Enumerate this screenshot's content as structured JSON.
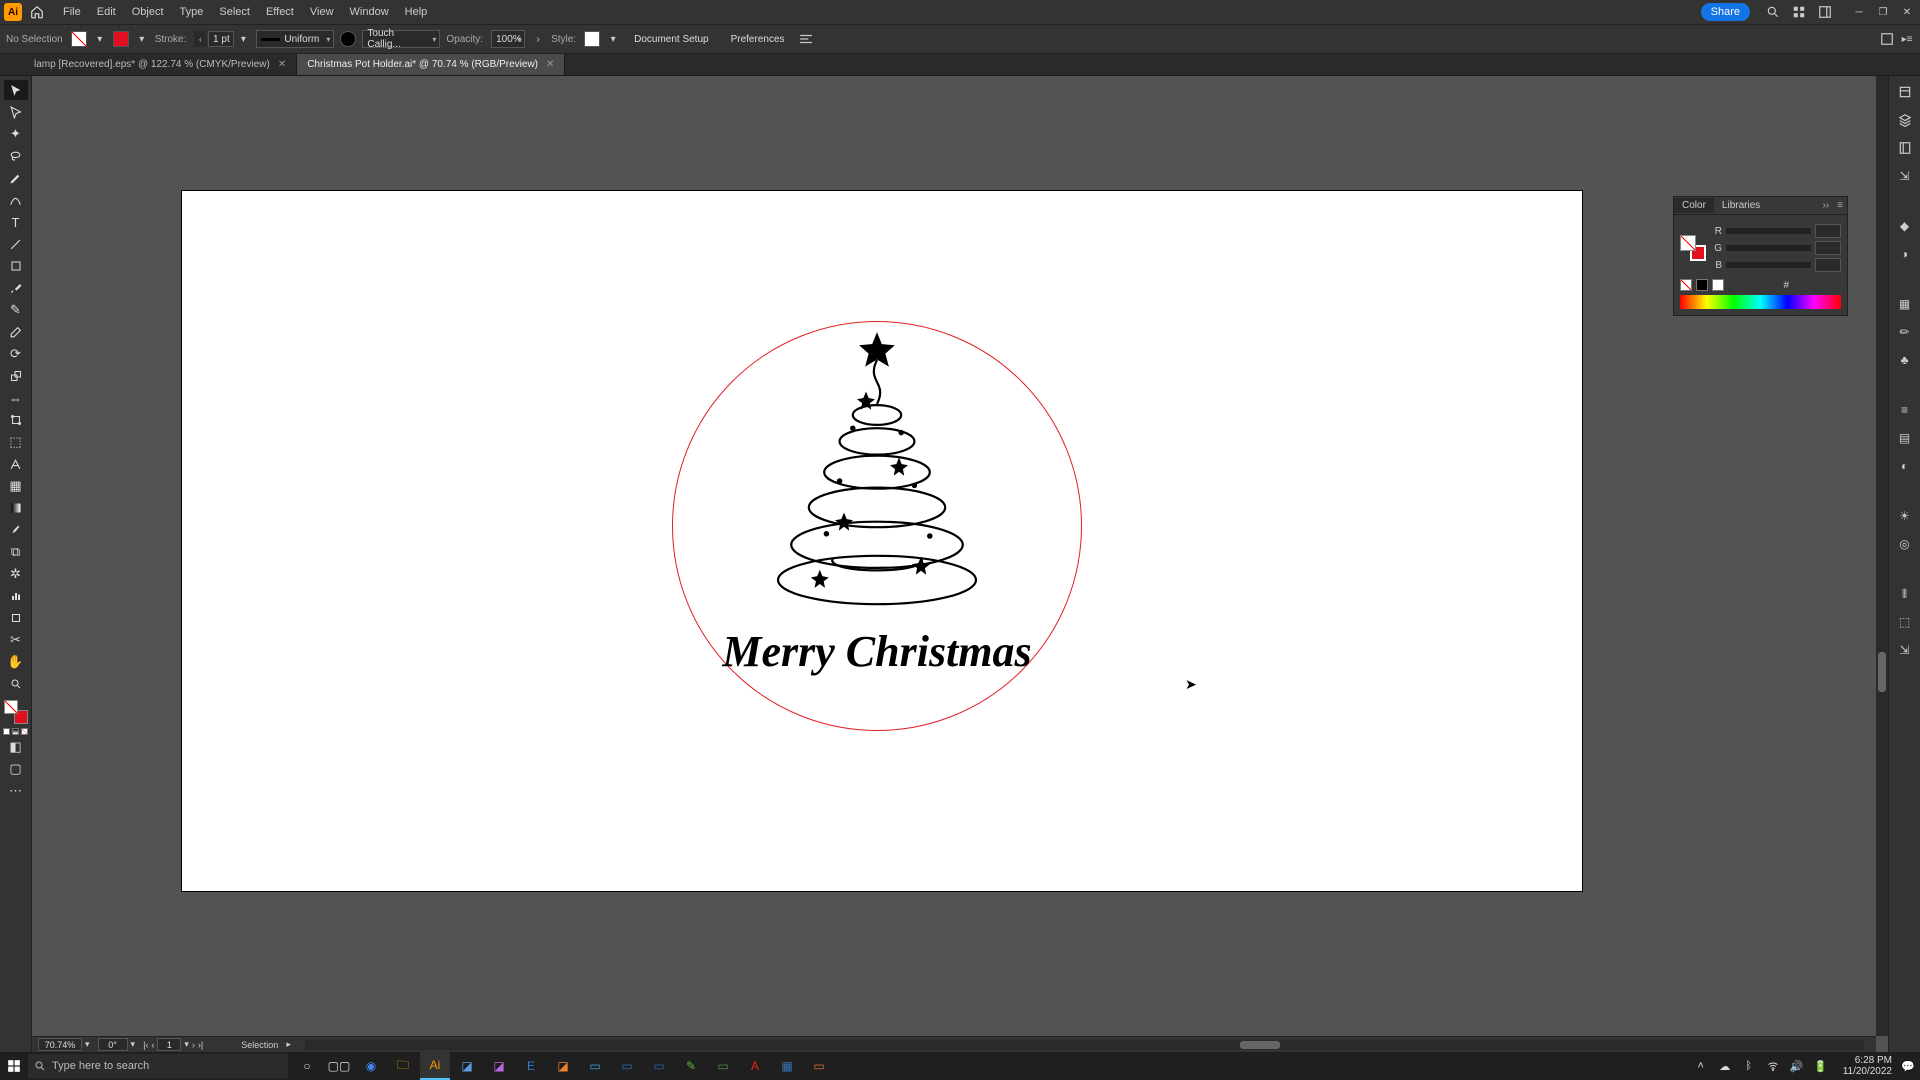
{
  "app": {
    "logo": "Ai",
    "menus": [
      "File",
      "Edit",
      "Object",
      "Type",
      "Select",
      "Effect",
      "View",
      "Window",
      "Help"
    ],
    "share_label": "Share"
  },
  "controlbar": {
    "no_selection": "No Selection",
    "stroke_label": "Stroke:",
    "stroke_value": "1 pt",
    "profile_label": "Uniform",
    "brush_label": "Touch Callig...",
    "opacity_label": "Opacity:",
    "opacity_value": "100%",
    "style_label": "Style:",
    "doc_setup": "Document Setup",
    "preferences": "Preferences"
  },
  "tabs": [
    {
      "label": "lamp [Recovered].eps* @ 122.74 % (CMYK/Preview)",
      "active": false
    },
    {
      "label": "Christmas Pot Holder.ai* @ 70.74 % (RGB/Preview)",
      "active": true
    }
  ],
  "tools": {
    "list": [
      "selection",
      "direct-selection",
      "magic-wand",
      "lasso",
      "pen",
      "curvature",
      "type",
      "line",
      "rectangle",
      "paintbrush",
      "shaper",
      "eraser",
      "rotate",
      "scale",
      "width",
      "free-transform",
      "shape-builder",
      "perspective",
      "mesh",
      "gradient",
      "eyedropper",
      "blend",
      "symbol-sprayer",
      "column-graph",
      "artboard",
      "slice",
      "hand",
      "zoom"
    ],
    "selected_index": 0
  },
  "artwork": {
    "greeting": "Merry Christmas",
    "ring_color": "#e21f26"
  },
  "color_panel": {
    "tab_color": "Color",
    "tab_libraries": "Libraries",
    "channels": [
      "R",
      "G",
      "B"
    ],
    "hex_label": "#"
  },
  "statusbar": {
    "zoom": "70.74%",
    "rotate": "0°",
    "artboard_nav": "1",
    "mode": "Selection"
  },
  "taskbar": {
    "search_placeholder": "Type here to search",
    "clock_time": "6:28 PM",
    "clock_date": "11/20/2022"
  },
  "colors": {
    "accent": "#1473e6",
    "stroke_red": "#e01020"
  }
}
